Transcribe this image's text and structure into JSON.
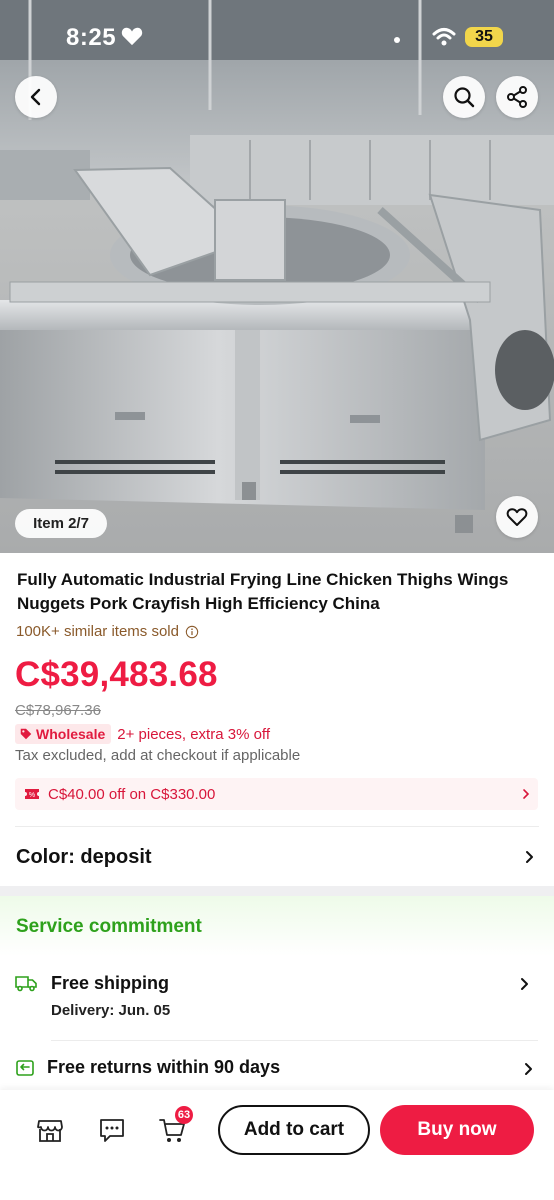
{
  "status_bar": {
    "time": "8:25",
    "battery": "35"
  },
  "gallery": {
    "position_label": "Item 2/7"
  },
  "product": {
    "title": "Fully Automatic Industrial Frying Line Chicken Thighs Wings Nuggets Pork Crayfish High Efficiency China",
    "sold": "100K+ similar items sold",
    "price": "C$39,483.68",
    "original_price": "C$78,967.36",
    "wholesale_badge": "Wholesale",
    "wholesale_text": "2+ pieces, extra 3% off",
    "tax_note": "Tax excluded, add at checkout if applicable"
  },
  "coupon": {
    "text": "C$40.00 off on C$330.00"
  },
  "variant": {
    "label": "Color: deposit"
  },
  "service": {
    "title": "Service commitment",
    "shipping_title": "Free shipping",
    "shipping_sub": "Delivery: Jun. 05",
    "returns_title": "Free returns within 90 days"
  },
  "bottom_bar": {
    "cart_count": "63",
    "add_to_cart": "Add to cart",
    "buy_now": "Buy now"
  },
  "colors": {
    "accent": "#ee1c43",
    "service_green": "#2ea11c",
    "sold_brown": "#8a5a2b"
  },
  "icons": [
    "back-arrow-icon",
    "search-icon",
    "share-icon",
    "heart-icon",
    "info-icon",
    "ticket-icon",
    "chevron-right-icon",
    "truck-icon",
    "return-icon",
    "store-icon",
    "message-icon",
    "cart-icon"
  ]
}
